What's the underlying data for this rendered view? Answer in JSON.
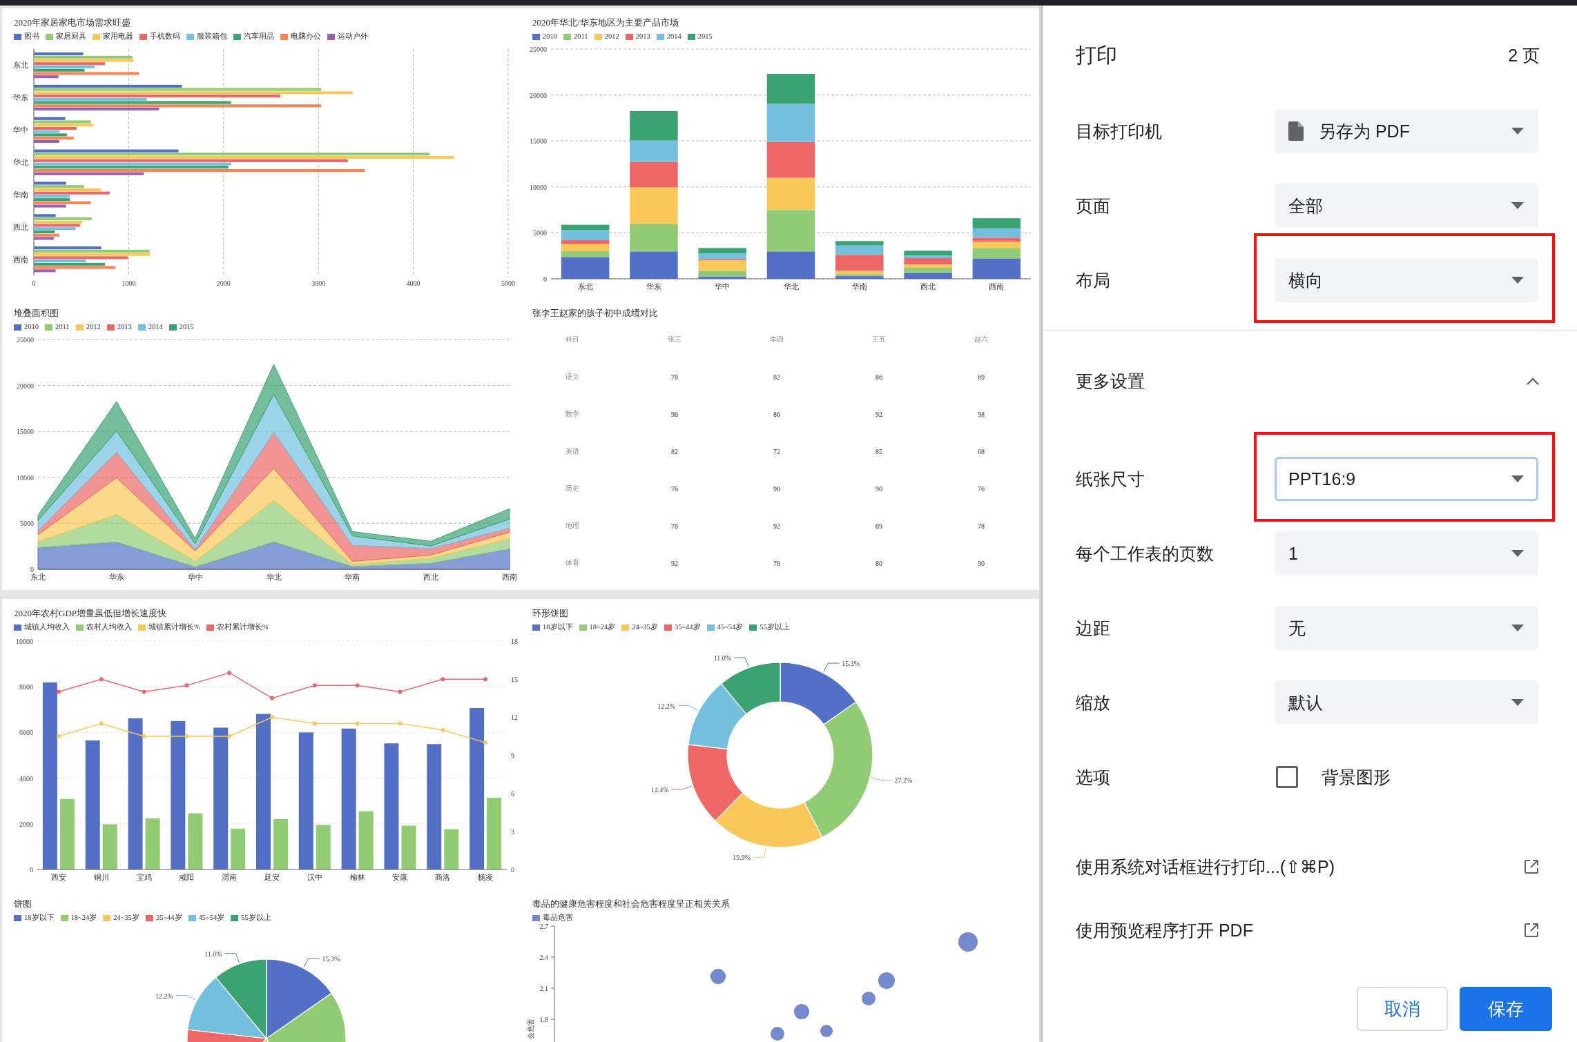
{
  "preview": {
    "pages": [
      {
        "panels": [
          {
            "title": "2020年家居家电市场需求旺盛",
            "chart_data": {
              "type": "bar",
              "orientation": "horizontal",
              "grid": true,
              "categories": [
                "东北",
                "华东",
                "华中",
                "华北",
                "华南",
                "西北",
                "西南"
              ],
              "xlim": [
                0,
                5000
              ],
              "xticks": [
                0,
                1000,
                2000,
                3000,
                4000,
                5000
              ],
              "series": [
                {
                  "name": "图书",
                  "color": "#5470c6",
                  "values": [
                    520,
                    1560,
                    330,
                    1525,
                    340,
                    230,
                    710
                  ]
                },
                {
                  "name": "家居厨具",
                  "color": "#91cc75",
                  "values": [
                    1040,
                    3030,
                    600,
                    4170,
                    530,
                    610,
                    1220
                  ]
                },
                {
                  "name": "家用电器",
                  "color": "#fac858",
                  "values": [
                    1050,
                    3360,
                    630,
                    4430,
                    710,
                    510,
                    1225
                  ]
                },
                {
                  "name": "手机数码",
                  "color": "#ee6666",
                  "values": [
                    750,
                    2600,
                    450,
                    3310,
                    800,
                    490,
                    990
                  ]
                },
                {
                  "name": "服装箱包",
                  "color": "#73c0de",
                  "values": [
                    640,
                    1190,
                    270,
                    2080,
                    380,
                    440,
                    550
                  ]
                },
                {
                  "name": "汽车用品",
                  "color": "#3ba272",
                  "values": [
                    535,
                    2080,
                    350,
                    2050,
                    380,
                    220,
                    750
                  ]
                },
                {
                  "name": "电脑办公",
                  "color": "#fc8452",
                  "values": [
                    1110,
                    3030,
                    420,
                    3490,
                    600,
                    270,
                    860
                  ]
                },
                {
                  "name": "运动户外",
                  "color": "#9a60b4",
                  "values": [
                    260,
                    1320,
                    270,
                    1160,
                    340,
                    210,
                    230
                  ]
                }
              ]
            }
          },
          {
            "title": "2020年华北/华东地区为主要产品市场",
            "chart_data": {
              "type": "bar",
              "stacked": true,
              "grid": true,
              "categories": [
                "东北",
                "华东",
                "华中",
                "华北",
                "华南",
                "西北",
                "西南"
              ],
              "ylim": [
                0,
                25000
              ],
              "yticks": [
                0,
                5000,
                10000,
                15000,
                20000,
                25000
              ],
              "series": [
                {
                  "name": "2010",
                  "color": "#5470c6",
                  "values": [
                    2360,
                    2980,
                    250,
                    2980,
                    290,
                    650,
                    2220
                  ]
                },
                {
                  "name": "2011",
                  "color": "#91cc75",
                  "values": [
                    650,
                    2980,
                    620,
                    4500,
                    220,
                    550,
                    1130
                  ]
                },
                {
                  "name": "2012",
                  "color": "#fac858",
                  "values": [
                    760,
                    4000,
                    1130,
                    3520,
                    360,
                    360,
                    690
                  ]
                },
                {
                  "name": "2013",
                  "color": "#ee6666",
                  "values": [
                    440,
                    2760,
                    150,
                    3890,
                    1740,
                    690,
                    440
                  ]
                },
                {
                  "name": "2014",
                  "color": "#73c0de",
                  "values": [
                    1090,
                    2330,
                    620,
                    4140,
                    1020,
                    290,
                    980
                  ]
                },
                {
                  "name": "2015",
                  "color": "#3ba272",
                  "values": [
                    580,
                    3200,
                    580,
                    3270,
                    470,
                    510,
                    1130
                  ]
                }
              ]
            }
          },
          {
            "title": "堆叠面积图",
            "chart_data": {
              "type": "area",
              "stacked": true,
              "grid": true,
              "categories": [
                "东北",
                "华东",
                "华中",
                "华北",
                "华南",
                "西北",
                "西南"
              ],
              "ylim": [
                0,
                25000
              ],
              "yticks": [
                0,
                5000,
                10000,
                15000,
                20000,
                25000
              ],
              "series": [
                {
                  "name": "2010",
                  "color": "#5470c6",
                  "values": [
                    2360,
                    2980,
                    250,
                    2980,
                    290,
                    650,
                    2220
                  ]
                },
                {
                  "name": "2011",
                  "color": "#91cc75",
                  "values": [
                    650,
                    2980,
                    620,
                    4500,
                    220,
                    550,
                    1130
                  ]
                },
                {
                  "name": "2012",
                  "color": "#fac858",
                  "values": [
                    760,
                    4000,
                    1130,
                    3520,
                    360,
                    360,
                    690
                  ]
                },
                {
                  "name": "2013",
                  "color": "#ee6666",
                  "values": [
                    440,
                    2760,
                    150,
                    3890,
                    1740,
                    690,
                    440
                  ]
                },
                {
                  "name": "2014",
                  "color": "#73c0de",
                  "values": [
                    1090,
                    2330,
                    620,
                    4140,
                    1020,
                    290,
                    980
                  ]
                },
                {
                  "name": "2015",
                  "color": "#3ba272",
                  "values": [
                    580,
                    3200,
                    580,
                    3270,
                    470,
                    510,
                    1130
                  ]
                }
              ]
            }
          },
          {
            "kind": "table",
            "title": "张李王赵家的孩子初中成绩对比",
            "columns": [
              "科目",
              "张三",
              "李四",
              "王五",
              "赵六"
            ],
            "rows": [
              [
                "语文",
                "78",
                "82",
                "86",
                "69"
              ],
              [
                "数学",
                "96",
                "86",
                "92",
                "98"
              ],
              [
                "英语",
                "82",
                "72",
                "85",
                "68"
              ],
              [
                "历史",
                "76",
                "90",
                "90",
                "76"
              ],
              [
                "地理",
                "78",
                "92",
                "89",
                "78"
              ],
              [
                "体育",
                "92",
                "78",
                "80",
                "90"
              ]
            ]
          }
        ]
      },
      {
        "panels": [
          {
            "title": "2020年农村GDP增量虽低但增长速度快",
            "chart_data": {
              "type": "bar",
              "grid": true,
              "categories": [
                "西安",
                "铜川",
                "宝鸡",
                "咸阳",
                "渭南",
                "延安",
                "汉中",
                "榆林",
                "安康",
                "商洛",
                "杨凌"
              ],
              "ylim": [
                0,
                10000
              ],
              "yticks": [
                0,
                2000,
                4000,
                6000,
                8000,
                10000
              ],
              "y2lim": [
                0,
                18
              ],
              "y2ticks": [
                0,
                3,
                6,
                9,
                12,
                15,
                18
              ],
              "series": [
                {
                  "name": "城镇人均收入",
                  "color": "#5470c6",
                  "type": "bar",
                  "values": [
                    8190,
                    5650,
                    6620,
                    6500,
                    6210,
                    6810,
                    6000,
                    6170,
                    5520,
                    5490,
                    7070
                  ]
                },
                {
                  "name": "农村人均收入",
                  "color": "#91cc75",
                  "type": "bar",
                  "values": [
                    3090,
                    1980,
                    2240,
                    2460,
                    1790,
                    2210,
                    1950,
                    2550,
                    1920,
                    1760,
                    3140
                  ]
                },
                {
                  "name": "城镇累计增长%",
                  "color": "#fac858",
                  "type": "line",
                  "axis": "y2",
                  "marker": "circle",
                  "values": [
                    10.5,
                    11.5,
                    10.5,
                    10.5,
                    10.5,
                    12,
                    11.5,
                    11.5,
                    11.5,
                    11,
                    10
                  ]
                },
                {
                  "name": "农村累计增长%",
                  "color": "#ee6666",
                  "type": "line",
                  "axis": "y2",
                  "marker": "circle",
                  "values": [
                    14,
                    15,
                    14,
                    14.5,
                    15.5,
                    13.5,
                    14.5,
                    14.5,
                    14,
                    15,
                    15
                  ]
                }
              ]
            }
          },
          {
            "title": "环形饼图",
            "chart_data": {
              "type": "donut",
              "categories": [
                "18岁以下",
                "18~24岁",
                "24~35岁",
                "35~44岁",
                "45~54岁",
                "55岁以上"
              ],
              "colors": [
                "#5470c6",
                "#91cc75",
                "#fac858",
                "#ee6666",
                "#73c0de",
                "#3ba272"
              ],
              "values": [
                15.3,
                27.2,
                19.9,
                14.4,
                12.2,
                11.0
              ],
              "value_labels": [
                "15.3%",
                "27.2%",
                "19.9%",
                "14.4%",
                "12.2%",
                "11.0%"
              ]
            }
          },
          {
            "title": "饼图",
            "chart_data": {
              "type": "pie",
              "categories": [
                "18岁以下",
                "18~24岁",
                "24~35岁",
                "35~44岁",
                "45~54岁",
                "55岁以上"
              ],
              "colors": [
                "#5470c6",
                "#91cc75",
                "#fac858",
                "#ee6666",
                "#73c0de",
                "#3ba272"
              ],
              "values": [
                15.3,
                27.2,
                19.9,
                14.4,
                12.2,
                11.0
              ],
              "value_labels": [
                "15.3%",
                null,
                null,
                null,
                "12.2%",
                "11.0%"
              ]
            }
          },
          {
            "kind": "scatter",
            "title": "毒品的健康危害程度和社会危害程度呈正相关关系",
            "legend": [
              {
                "name": "毒品危害",
                "color": "#7289ce"
              }
            ],
            "yticks": [
              "2.7",
              "2.4",
              "2.1",
              "1.8"
            ],
            "ylabel": "会危害"
          }
        ]
      }
    ]
  },
  "print_panel": {
    "title": "打印",
    "page_count": "2 页",
    "settings": [
      {
        "kind": "destination",
        "label": "目标打印机",
        "value": "另存为 PDF",
        "highlighted": false,
        "focused": false
      },
      {
        "kind": "select",
        "label": "页面",
        "value": "全部",
        "highlighted": false,
        "focused": false
      },
      {
        "kind": "select",
        "label": "布局",
        "value": "横向",
        "highlighted": true,
        "focused": false
      }
    ],
    "more_settings": {
      "label": "更多设置",
      "expanded": true,
      "settings": [
        {
          "kind": "select",
          "label": "纸张尺寸",
          "value": "PPT16:9",
          "highlighted": true,
          "focused": true
        },
        {
          "kind": "select",
          "label": "每个工作表的页数",
          "value": "1",
          "highlighted": false,
          "focused": false
        },
        {
          "kind": "select",
          "label": "边距",
          "value": "无",
          "highlighted": false,
          "focused": false
        },
        {
          "kind": "select",
          "label": "缩放",
          "value": "默认",
          "highlighted": false,
          "focused": false
        },
        {
          "kind": "checkbox",
          "label": "选项",
          "value": "背景图形",
          "checked": false
        }
      ]
    },
    "links": [
      {
        "label": "使用系统对话框进行打印...(⇧⌘P)"
      },
      {
        "label": "使用预览程序打开 PDF"
      }
    ],
    "buttons": [
      {
        "kind": "secondary",
        "label": "取消"
      },
      {
        "kind": "primary",
        "label": "保存"
      }
    ]
  }
}
